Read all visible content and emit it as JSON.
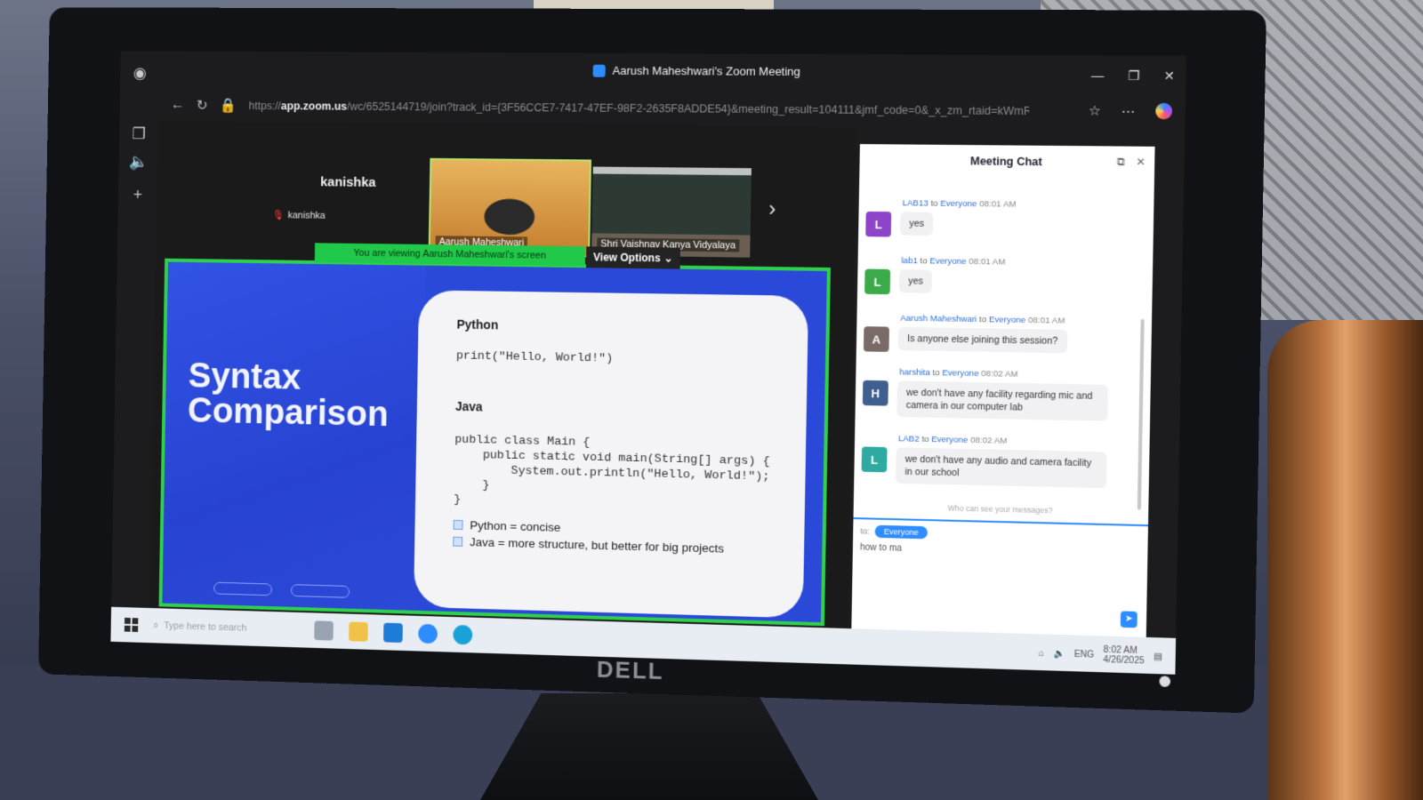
{
  "browser": {
    "tab_title": "Aarush Maheshwari's Zoom Meeting",
    "url_scheme": "https://",
    "url_host": "app.zoom.us",
    "url_rest": "/wc/6525144719/join?track_id={3F56CCE7-7417-47EF-98F2-2635F8ADDE54}&meeting_result=104111&jmf_code=0&_x_zm_rtaid=kWmRo..."
  },
  "meeting": {
    "self_name_large": "kanishka",
    "self_name_small": "kanishka",
    "tiles": [
      {
        "name": "Aarush Maheshwari"
      },
      {
        "name": "Shri Vaishnav Kanya Vidyalaya"
      }
    ],
    "viewing_banner": "You are viewing  Aarush Maheshwari's screen",
    "view_options": "View Options"
  },
  "slide": {
    "title_line1": "Syntax",
    "title_line2": "Comparison",
    "python_label": "Python",
    "python_code": "print(\"Hello, World!\")",
    "java_label": "Java",
    "java_code": "public class Main {\n    public static void main(String[] args) {\n        System.out.println(\"Hello, World!\");\n    }\n}",
    "bullets": [
      "Python = concise",
      "Java = more structure, but better for big projects"
    ]
  },
  "chat": {
    "title": "Meeting Chat",
    "messages": [
      {
        "sender": "LAB13",
        "to": "to",
        "recipient": "Everyone",
        "time": "08:01 AM",
        "initial": "L",
        "text": "yes",
        "color": "#8e44c9"
      },
      {
        "sender": "lab1",
        "to": "to",
        "recipient": "Everyone",
        "time": "08:01 AM",
        "initial": "L",
        "text": "yes",
        "color": "#3bab4a"
      },
      {
        "sender": "Aarush Maheshwari",
        "to": "to",
        "recipient": "Everyone",
        "time": "08:01 AM",
        "initial": "A",
        "text": "Is anyone else joining this session?",
        "color": "#7b6b66"
      },
      {
        "sender": "harshita",
        "to": "to",
        "recipient": "Everyone",
        "time": "08:02 AM",
        "initial": "H",
        "text": "we don't have any facility regarding mic and camera in our computer lab",
        "color": "#3f5f8e"
      },
      {
        "sender": "LAB2",
        "to": "to",
        "recipient": "Everyone",
        "time": "08:02 AM",
        "initial": "L",
        "text": "we don't have any audio and camera facility in our school",
        "color": "#2eaaa0"
      }
    ],
    "who_hint": "Who can see your messages?",
    "to_label": "to:",
    "recipient": "Everyone",
    "input_value": "how to ma"
  },
  "taskbar": {
    "search_placeholder": "Type here to search",
    "lang": "ENG",
    "time": "8:02 AM",
    "date": "4/26/2025"
  }
}
